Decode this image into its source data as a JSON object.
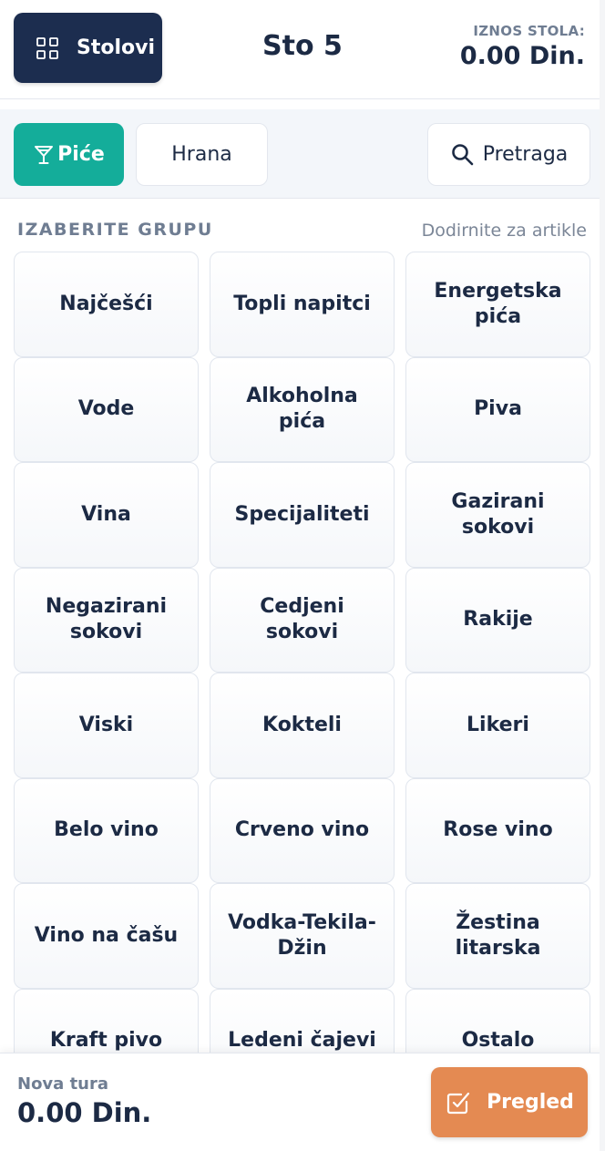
{
  "header": {
    "tables_label": "Stolovi",
    "table_name": "Sto 5",
    "amount_label": "IZNOS STOLA:",
    "amount_value": "0.00 Din."
  },
  "categories": {
    "drinks": "Piće",
    "food": "Hrana",
    "search": "Pretraga"
  },
  "groups": {
    "title": "IZABERITE GRUPU",
    "hint": "Dodirnite za artikle",
    "items": [
      "Najčešći",
      "Topli napitci",
      "Energetska pića",
      "Vode",
      "Alkoholna pića",
      "Piva",
      "Vina",
      "Specijaliteti",
      "Gazirani sokovi",
      "Negazirani sokovi",
      "Cedjeni sokovi",
      "Rakije",
      "Viski",
      "Kokteli",
      "Likeri",
      "Belo vino",
      "Crveno vino",
      "Rose vino",
      "Vino na čašu",
      "Vodka-Tekila-Džin",
      "Žestina litarska",
      "Kraft pivo",
      "Ledeni čajevi",
      "Ostalo"
    ]
  },
  "footer": {
    "round_label": "Nova tura",
    "round_value": "0.00 Din.",
    "review_label": "Pregled"
  },
  "colors": {
    "navy": "#1c2d4f",
    "teal": "#14ad9a",
    "orange": "#e48a52"
  }
}
